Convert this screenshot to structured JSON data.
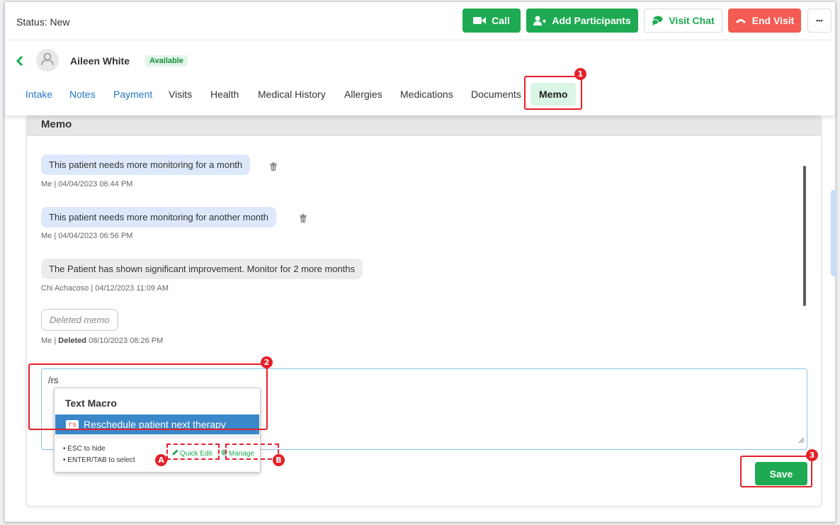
{
  "header": {
    "status": "Status: New",
    "actions": {
      "call": "Call",
      "add_participants": "Add Participants",
      "visit_chat": "Visit Chat",
      "end_visit": "End Visit",
      "more": "•••"
    }
  },
  "patient": {
    "name": "Aileen White",
    "availability": "Available"
  },
  "tabs": [
    {
      "label": "Intake"
    },
    {
      "label": "Notes"
    },
    {
      "label": "Payment"
    },
    {
      "label": "Visits"
    },
    {
      "label": "Health"
    },
    {
      "label": "Medical History"
    },
    {
      "label": "Allergies"
    },
    {
      "label": "Medications"
    },
    {
      "label": "Documents"
    },
    {
      "label": "Memo"
    }
  ],
  "memo": {
    "title": "Memo",
    "items": [
      {
        "text": "This patient needs more monitoring for a month",
        "meta": "Me | 04/04/2023 06:44 PM"
      },
      {
        "text": "This patient needs more monitoring for another month",
        "meta": "Me | 04/04/2023 06:56 PM"
      },
      {
        "text": "The Patient has shown significant improvement. Monitor for 2 more months",
        "meta": "Chi Achacoso | 04/12/2023 11:09 AM"
      },
      {
        "text": "Deleted memo",
        "meta_prefix": "Me | ",
        "meta_bold": "Deleted",
        "meta_suffix": " 08/10/2023 08:26 PM"
      }
    ],
    "input_value": "/rs",
    "save_label": "Save"
  },
  "macro_popup": {
    "title": "Text Macro",
    "item_code": "rs",
    "item_label": "Reschedule patient next therapy",
    "hints": [
      "ESC to hide",
      "ENTER/TAB to select"
    ],
    "quick_edit": "Quick Edit",
    "manage": "Manage"
  },
  "annotations": {
    "n1": "1",
    "n2": "2",
    "n3": "3",
    "a": "A",
    "b": "B"
  },
  "colors": {
    "accent_green": "#1eaa52",
    "end_red": "#f35b53",
    "link_blue": "#2678c7",
    "highlight_blue": "#3a87c9",
    "annotation_red": "#e4202a"
  }
}
